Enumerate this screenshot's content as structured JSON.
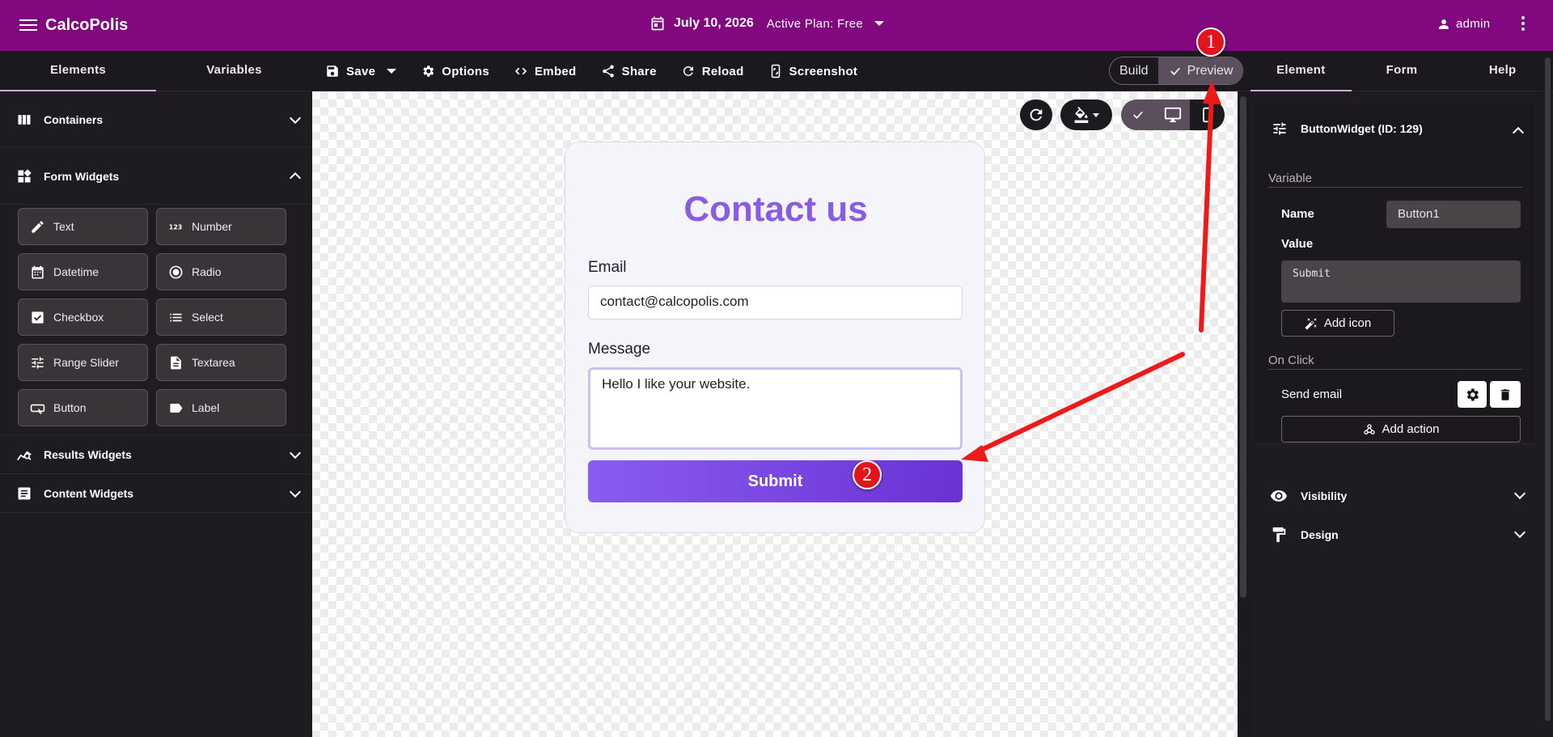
{
  "appbar": {
    "brand": "CalcoPolis",
    "date": "July 10, 2026",
    "plan": "Active Plan: Free",
    "user": "admin",
    "color": "#820880"
  },
  "left_tabs": [
    "Elements",
    "Variables"
  ],
  "toolbar": {
    "save": "Save",
    "options": "Options",
    "embed": "Embed",
    "share": "Share",
    "reload": "Reload",
    "screenshot": "Screenshot"
  },
  "mode_toggle": {
    "build": "Build",
    "preview": "Preview",
    "selected": "Preview"
  },
  "right_tabs": [
    "Element",
    "Form",
    "Help"
  ],
  "sidebar": {
    "containers": "Containers",
    "form_widgets": "Form Widgets",
    "widgets": [
      {
        "label": "Text",
        "icon": "pencil-icon"
      },
      {
        "label": "Number",
        "icon": "number-icon"
      },
      {
        "label": "Datetime",
        "icon": "calendar-icon"
      },
      {
        "label": "Radio",
        "icon": "radio-icon"
      },
      {
        "label": "Checkbox",
        "icon": "checkbox-icon"
      },
      {
        "label": "Select",
        "icon": "list-icon"
      },
      {
        "label": "Range Slider",
        "icon": "sliders-icon"
      },
      {
        "label": "Textarea",
        "icon": "document-icon"
      },
      {
        "label": "Button",
        "icon": "button-icon"
      },
      {
        "label": "Label",
        "icon": "label-icon"
      }
    ],
    "results_widgets": "Results Widgets",
    "content_widgets": "Content Widgets"
  },
  "form": {
    "title": "Contact us",
    "email_label": "Email",
    "email_value": "contact@calcopolis.com",
    "message_label": "Message",
    "message_value": "Hello I like your website.",
    "submit_label": "Submit",
    "accent": "#8a5be4"
  },
  "inspector": {
    "widget_title": "ButtonWidget (ID: 129)",
    "variable_heading": "Variable",
    "name_label": "Name",
    "name_value": "Button1",
    "value_label": "Value",
    "value_value": "Submit",
    "add_icon": "Add icon",
    "onclick_heading": "On Click",
    "action_label": "Send email",
    "add_action": "Add action",
    "visibility": "Visibility",
    "design": "Design"
  },
  "annotations": {
    "badge1": "1",
    "badge2": "2",
    "color": "#e3141b"
  }
}
